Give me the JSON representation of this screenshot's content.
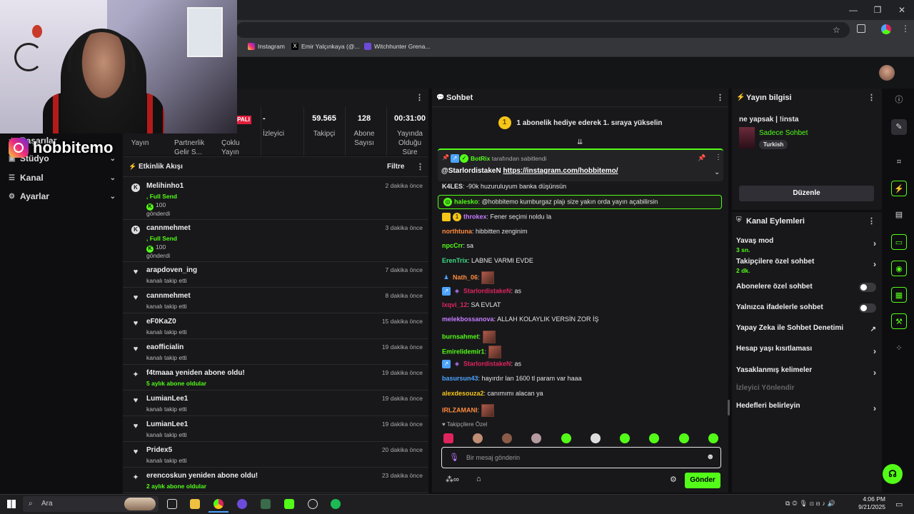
{
  "browser": {
    "bookmarks": [
      "Instagram",
      "Emir Yalçınkaya (@...",
      "Witchhunter Grena..."
    ],
    "window_controls": [
      "—",
      "❐",
      "✕"
    ]
  },
  "overlay": {
    "instagram_handle": "hobbitemo"
  },
  "left_nav": [
    {
      "label": "Başarılar",
      "icon": "trophy-icon"
    },
    {
      "label": "Stüdyo",
      "icon": "studio-icon"
    },
    {
      "label": "Kanal",
      "icon": "channel-icon"
    },
    {
      "label": "Ayarlar",
      "icon": "gear-icon"
    }
  ],
  "stats": [
    {
      "value": "",
      "label": "Yayın"
    },
    {
      "value": "",
      "label": "Partnerlik Gelir S..."
    },
    {
      "value": "",
      "label": "Çoklu Yayın"
    },
    {
      "value": "-",
      "label": "İzleyici"
    },
    {
      "value": "59.565",
      "label": "Takipçi"
    },
    {
      "value": "128",
      "label": "Abone Sayısı"
    },
    {
      "value": "00:31:00",
      "label": "Yayında Olduğu Süre"
    }
  ],
  "stats_badge": "PALI",
  "activity": {
    "title": "Etkinlik Akışı",
    "filter_label": "Filtre",
    "rows": [
      {
        "name": "Melihinho1",
        "sub": ", Full Send",
        "extra": "100",
        "extra2": "gönderdi",
        "time": "2 dakika önce",
        "type": "kick"
      },
      {
        "name": "cannmehmet",
        "sub": ", Full Send",
        "extra": "100",
        "extra2": "gönderdi",
        "time": "3 dakika önce",
        "type": "kick"
      },
      {
        "name": "arapdoven_ing",
        "sub": "kanalı takip etti",
        "time": "7 dakika önce",
        "type": "follow"
      },
      {
        "name": "cannmehmet",
        "sub": "kanalı takip etti",
        "time": "8 dakika önce",
        "type": "follow"
      },
      {
        "name": "eF0KaZ0",
        "sub": "kanalı takip etti",
        "time": "15 dakika önce",
        "type": "follow"
      },
      {
        "name": "eaofficialin",
        "sub": "kanalı takip etti",
        "time": "19 dakika önce",
        "type": "follow"
      },
      {
        "name": "f4tmaaa yeniden abone oldu!",
        "sub": "5 aylık abone oldular",
        "time": "19 dakika önce",
        "type": "sub"
      },
      {
        "name": "LumianLee1",
        "sub": "kanalı takip etti",
        "time": "19 dakika önce",
        "type": "follow"
      },
      {
        "name": "LumianLee1",
        "sub": "kanalı takip etti",
        "time": "19 dakika önce",
        "type": "follow"
      },
      {
        "name": "Pridex5",
        "sub": "kanalı takip etti",
        "time": "20 dakika önce",
        "type": "follow"
      },
      {
        "name": "erencoskun yeniden abone oldu!",
        "sub": "2 aylık abone oldular",
        "time": "23 dakika önce",
        "type": "sub"
      }
    ]
  },
  "chat": {
    "title": "Sohbet",
    "goal_number": "1",
    "goal_text": "1 abonelik hediye ederek 1. sıraya yükselin",
    "pinned": {
      "by_user": "BotRix",
      "by_text": "tarafından sabitlendi",
      "mention": "@StarlordistakeN",
      "link": "https://instagram.com/hobbitemo/"
    },
    "messages": [
      {
        "user": "K4LES",
        "color": "#e8e8e8",
        "text": "-90k huzuruluyum banka düşünsün"
      },
      {
        "user": "halesko",
        "color": "#53fc18",
        "text": "@hobbitemo kumburgaz plajı size yakın orda yayın açabilirsin",
        "highlight": true
      },
      {
        "user": "throkex",
        "color": "#c67cff",
        "text": "Fener seçimi noldu la"
      },
      {
        "user": "northtuna",
        "color": "#ff8a3d",
        "text": "hibbitten zenginim"
      },
      {
        "user": "npcCrr",
        "color": "#53fc18",
        "text": "sa"
      },
      {
        "user": "ErenTrix",
        "color": "#3ddc84",
        "text": "LABNE VARMI EVDE"
      },
      {
        "user": "Nath_06",
        "color": "#ff8a3d",
        "text": "",
        "emote": true
      },
      {
        "user": "StarlordistakeN",
        "color": "#e0245e",
        "text": "as"
      },
      {
        "user": "lxqvi_12",
        "color": "#e0245e",
        "text": "SA EVLAT"
      },
      {
        "user": "melekbossanova",
        "color": "#c67cff",
        "text": "ALLAH KOLAYLIK VERSİN ZOR İŞ"
      },
      {
        "user": "burnsahmet",
        "color": "#53fc18",
        "text": "",
        "emote": true
      },
      {
        "user": "Emirelidemir1",
        "color": "#53fc18",
        "text": "",
        "emote": true
      },
      {
        "user": "StarlordistakeN",
        "color": "#e0245e",
        "text": "as"
      },
      {
        "user": "basursun43",
        "color": "#4da3ff",
        "text": "hayırdır lan 1600 tl param var haaa"
      },
      {
        "user": "alexdesouza2",
        "color": "#f5c518",
        "text": "canımımı alacan ya"
      },
      {
        "user": "IRLZAMANI",
        "color": "#ff8a3d",
        "text": "",
        "emote": true
      }
    ],
    "followers_only": "Takipçilere Özel",
    "input_placeholder": "Bir mesaj gönderin",
    "send_label": "Gönder"
  },
  "stream_info": {
    "title": "Yayın bilgisi",
    "stream_title": "ne yapsak | !insta",
    "category": "Sadece Sohbet",
    "language": "Turkish",
    "edit_label": "Düzenle"
  },
  "channel_actions": {
    "title": "Kanal Eylemleri",
    "items": [
      {
        "label": "Yavaş mod",
        "value": "3 sn.",
        "control": "chevron"
      },
      {
        "label": "Takipçilere özel sohbet",
        "value": "2 dk.",
        "control": "chevron"
      },
      {
        "label": "Abonelere özel sohbet",
        "control": "toggle"
      },
      {
        "label": "Yalnızca ifadelerle sohbet",
        "control": "toggle"
      },
      {
        "label": "Yapay Zeka ile Sohbet Denetimi",
        "control": "external"
      },
      {
        "label": "Hesap yaşı kısıtlaması",
        "control": "chevron"
      },
      {
        "label": "Yasaklanmış kelimeler",
        "control": "chevron"
      },
      {
        "label": "İzleyici Yönlendir",
        "control": "none",
        "disabled": true
      },
      {
        "label": "Hedefleri belirleyin",
        "control": "chevron"
      }
    ]
  },
  "taskbar": {
    "search_placeholder": "Ara",
    "time": "4:06 PM",
    "date": "9/21/2025"
  },
  "colors": {
    "accent": "#53fc18",
    "panel": "#18181b",
    "background": "#0e0e10"
  }
}
